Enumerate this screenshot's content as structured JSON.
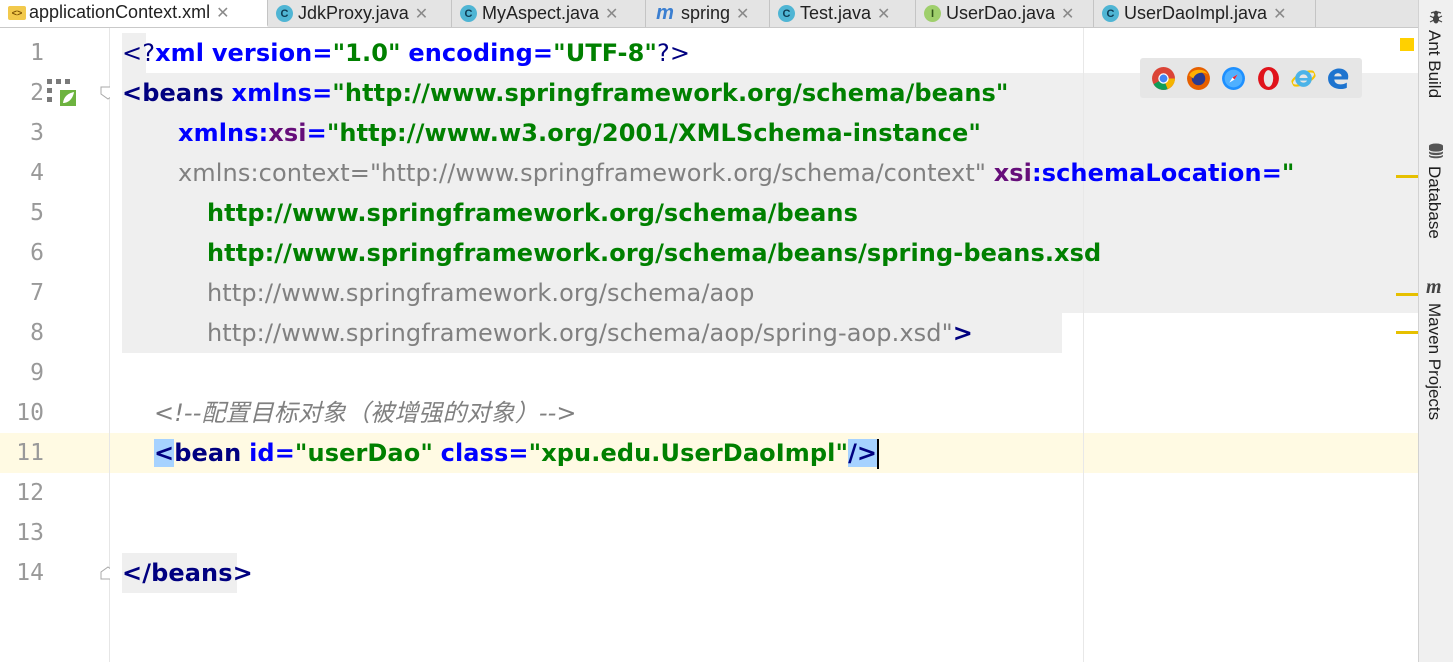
{
  "tabs": [
    {
      "label": "applicationContext.xml",
      "icon": "xml-file-icon",
      "active": true
    },
    {
      "label": "JdkProxy.java",
      "icon": "class-icon"
    },
    {
      "label": "MyAspect.java",
      "icon": "class-icon"
    },
    {
      "label": "spring",
      "icon": "module-icon"
    },
    {
      "label": "Test.java",
      "icon": "class-icon"
    },
    {
      "label": "UserDao.java",
      "icon": "interface-icon"
    },
    {
      "label": "UserDaoImpl.java",
      "icon": "class-icon"
    }
  ],
  "line_numbers": [
    "1",
    "2",
    "3",
    "4",
    "5",
    "6",
    "7",
    "8",
    "9",
    "10",
    "11",
    "12",
    "13",
    "14"
  ],
  "code": {
    "l1": {
      "open": "<?",
      "name": "xml",
      "a1": "version",
      "eq1": "=",
      "v1": "\"1.0\"",
      "a2": "encoding",
      "eq2": "=",
      "v2": "\"UTF-8\"",
      "close": "?>"
    },
    "l2": {
      "open": "<",
      "name": "beans",
      "attr": "xmlns",
      "eq": "=",
      "val": "\"http://www.springframework.org/schema/beans\""
    },
    "l3": {
      "attr": "xmlns",
      "colon": ":",
      "ns": "xsi",
      "eq": "=",
      "val": "\"http://www.w3.org/2001/XMLSchema-instance\""
    },
    "l4": {
      "attr_unused": "xmlns:context=\"http://www.springframework.org/schema/context\"",
      "ns": "xsi",
      "colon": ":",
      "attr": "schemaLocation",
      "eq": "=",
      "quote": "\""
    },
    "l5": "http://www.springframework.org/schema/beans",
    "l6": "http://www.springframework.org/schema/beans/spring-beans.xsd",
    "l7": "http://www.springframework.org/schema/aop",
    "l8": {
      "text": "http://www.springframework.org/schema/aop/spring-aop.xsd",
      "quote": "\"",
      "close": ">"
    },
    "l10": "<!--配置目标对象（被增强的对象）-->",
    "l11": {
      "open": "<",
      "name": "bean",
      "a1": "id",
      "eq1": "=",
      "v1": "\"userDao\"",
      "a2": "class",
      "eq2": "=",
      "v2": "\"xpu.edu.UserDaoImpl\"",
      "close": "/>"
    },
    "l14": {
      "open": "</",
      "name": "beans",
      "close": ">"
    }
  },
  "browser_popup": [
    "chrome-icon",
    "firefox-icon",
    "safari-icon",
    "opera-icon",
    "ie-icon",
    "edge-icon"
  ],
  "right_tools": [
    {
      "label": "Ant Build",
      "icon": "ant-icon"
    },
    {
      "label": "Database",
      "icon": "database-icon"
    },
    {
      "label": "Maven Projects",
      "icon": "maven-icon"
    }
  ],
  "colors": {
    "tag": "#000080",
    "attribute": "#0000ff",
    "namespace": "#660e7a",
    "value": "#008000",
    "comment": "#808080",
    "caret_line": "#fffae3"
  }
}
